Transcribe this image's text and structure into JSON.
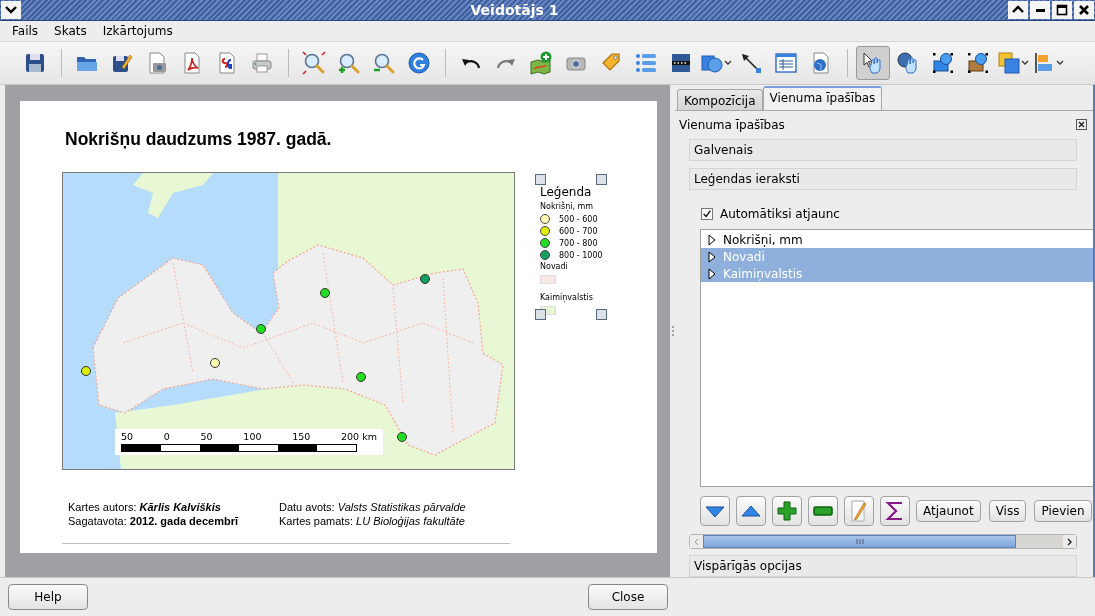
{
  "window": {
    "title": "Veidotājs 1"
  },
  "menu": [
    {
      "label": "Fails"
    },
    {
      "label": "Skats"
    },
    {
      "label": "Izkārtojums"
    }
  ],
  "toolbar": {
    "groups": [
      [
        {
          "selected": false,
          "has_menu": false
        }
      ],
      [
        {
          "selected": false,
          "has_menu": false
        },
        {
          "selected": false,
          "has_menu": false
        },
        {
          "selected": false,
          "has_menu": false
        },
        {
          "selected": false,
          "has_menu": false
        },
        {
          "selected": false,
          "has_menu": false
        },
        {
          "selected": false,
          "has_menu": false
        }
      ],
      [
        {
          "selected": false,
          "has_menu": false
        },
        {
          "selected": false,
          "has_menu": false
        },
        {
          "selected": false,
          "has_menu": false
        },
        {
          "selected": false,
          "has_menu": false
        }
      ],
      [
        {
          "selected": false,
          "has_menu": false
        },
        {
          "selected": false,
          "has_menu": false
        },
        {
          "selected": false,
          "has_menu": false
        },
        {
          "selected": false,
          "has_menu": false
        },
        {
          "selected": false,
          "has_menu": false
        },
        {
          "selected": false,
          "has_menu": false
        },
        {
          "selected": false,
          "has_menu": false
        },
        {
          "selected": false,
          "has_menu": true
        },
        {
          "selected": false,
          "has_menu": false
        },
        {
          "selected": false,
          "has_menu": false
        },
        {
          "selected": false,
          "has_menu": false
        }
      ],
      [
        {
          "selected": true,
          "has_menu": false
        },
        {
          "selected": false,
          "has_menu": false
        },
        {
          "selected": false,
          "has_menu": false
        },
        {
          "selected": false,
          "has_menu": false
        },
        {
          "selected": false,
          "has_menu": true
        },
        {
          "selected": false,
          "has_menu": true
        }
      ]
    ]
  },
  "page": {
    "title": "Nokrišņu daudzums 1987. gadā.",
    "map": {
      "kind": "picture",
      "scale_bar": {
        "labels": [
          "50",
          "0",
          "50",
          "100",
          "150",
          "200 km"
        ]
      }
    },
    "legend": {
      "title": "Leģenda",
      "selected": true,
      "groups": [
        {
          "name": "Nokrišņi, mm",
          "items": [
            {
              "kind": "dot",
              "label": "500 - 600",
              "color": "#ffffb4"
            },
            {
              "kind": "dot",
              "label": "600 - 700",
              "color": "#dcf000"
            },
            {
              "kind": "dot",
              "label": "700 - 800",
              "color": "#22dd22"
            },
            {
              "kind": "dot",
              "label": "800 - 1000",
              "color": "#12a060"
            }
          ]
        },
        {
          "name": "Novadi",
          "items": [
            {
              "kind": "swatch",
              "color": "#f7e8e6"
            }
          ]
        },
        {
          "name": "Kaimiņvalstis",
          "items": [
            {
              "kind": "swatch",
              "color": "#e6f6d4"
            }
          ]
        }
      ]
    },
    "credits": [
      {
        "label": "Kartes autors:",
        "value": "Kārlis Kalviškis"
      },
      {
        "label": "Sagatavota:",
        "value": "2012. gada decembrī"
      },
      {
        "label": "Datu avots:",
        "value": "Valsts Statistikas pārvalde"
      },
      {
        "label": "Kartes pamats:",
        "value": "LU Bioloģijas fakultāte"
      }
    ]
  },
  "tabs": [
    {
      "label": "Kompozīcija",
      "selected": false
    },
    {
      "label": "Vienuma īpašības",
      "selected": true
    }
  ],
  "panel": {
    "title": "Vienuma īpašības",
    "sections": [
      {
        "label": "Galvenais"
      },
      {
        "label": "Leģendas ieraksti"
      }
    ],
    "auto_update": {
      "label": "Automātiksi atjaunc",
      "checked": true
    },
    "tree": [
      {
        "label": "Nokrišņi, mm",
        "selected": false,
        "expanded": false
      },
      {
        "label": "Novadi",
        "selected": true,
        "expanded": false
      },
      {
        "label": "Kaimiņvalstis",
        "selected": true,
        "expanded": false
      }
    ],
    "tools": [
      {
        "kind": "icon"
      },
      {
        "kind": "icon"
      },
      {
        "kind": "icon"
      },
      {
        "kind": "icon"
      },
      {
        "kind": "icon"
      },
      {
        "kind": "icon"
      },
      {
        "kind": "text",
        "label": "Atjaunot"
      },
      {
        "kind": "text",
        "label": "Viss"
      },
      {
        "kind": "text",
        "label": "Pievien"
      }
    ],
    "footer_section": {
      "label": "Vispārīgās opcijas"
    }
  },
  "buttons": [
    {
      "label": "Help"
    },
    {
      "label": "Close"
    }
  ]
}
